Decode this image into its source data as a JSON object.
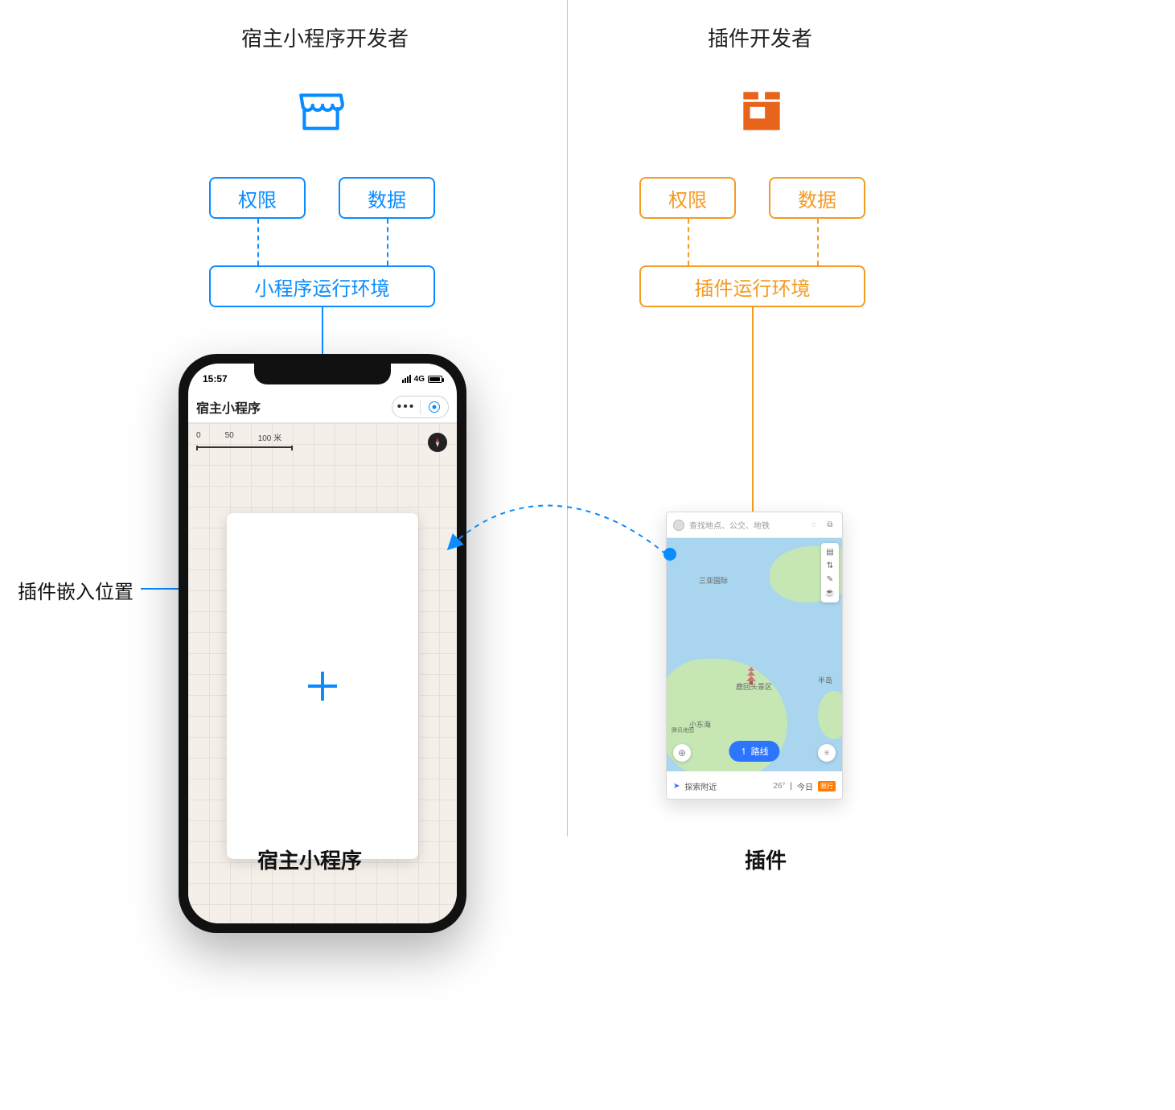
{
  "left": {
    "title": "宿主小程序开发者",
    "permission": "权限",
    "data": "数据",
    "runtime": "小程序运行环境",
    "bottom_title": "宿主小程序",
    "annotation": "插件嵌入位置"
  },
  "right": {
    "title": "插件开发者",
    "permission": "权限",
    "data": "数据",
    "runtime": "插件运行环境",
    "bottom_title": "插件"
  },
  "phone": {
    "time": "15:57",
    "signal": "4G",
    "app_title": "宿主小程序",
    "scale_labels": {
      "a": "0",
      "b": "50",
      "c": "100 米"
    }
  },
  "plugin": {
    "search_placeholder": "查找地点、公交、地铁",
    "poi1": "三亚国际",
    "poi2": "鹿回头景区",
    "poi3": "半岛",
    "poi4": "小东海",
    "route_btn": "路线",
    "map_attr": "腾讯地图",
    "explore": "探索附近",
    "temp": "26°",
    "today": "今日",
    "restrict": "限行"
  },
  "colors": {
    "blue": "#0a8cff",
    "orange": "#f59a23"
  }
}
